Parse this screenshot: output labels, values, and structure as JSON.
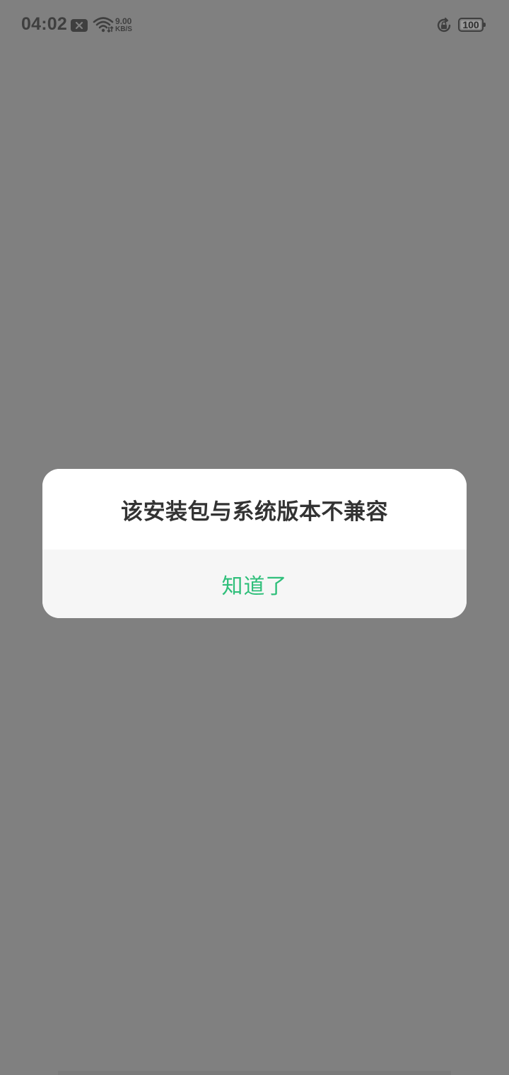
{
  "status_bar": {
    "time": "04:02",
    "net_speed_value": "9.00",
    "net_speed_unit": "KB/S",
    "battery_level": "100",
    "icons": [
      "no-sim-icon",
      "wifi-icon",
      "rotation-lock-icon",
      "battery-icon"
    ]
  },
  "dialog": {
    "title": "该安装包与系统版本不兼容",
    "ok_label": "知道了"
  },
  "colors": {
    "scrim": "#808080",
    "accent_green": "#2fbf7a",
    "dialog_bg": "#ffffff",
    "footer_bg": "#f6f6f6",
    "title_text": "#333333"
  }
}
